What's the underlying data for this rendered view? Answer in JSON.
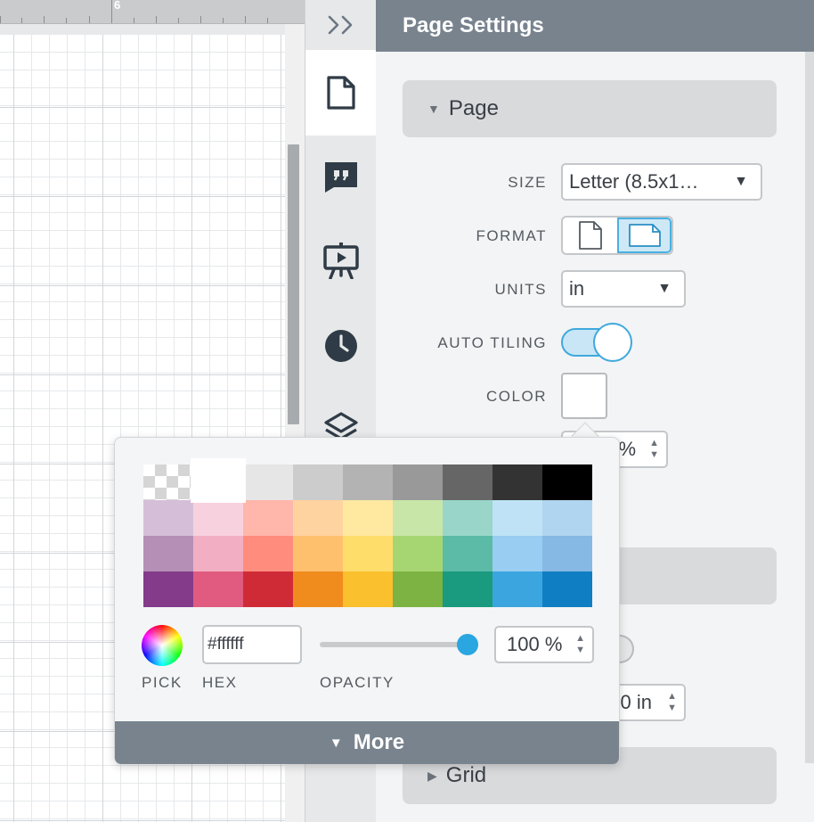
{
  "ruler": {
    "label": "6"
  },
  "rail": {
    "items": [
      {
        "icon": "page-icon",
        "active": true
      },
      {
        "icon": "quote-icon",
        "active": false
      },
      {
        "icon": "presentation-icon",
        "active": false
      },
      {
        "icon": "clock-icon",
        "active": false
      },
      {
        "icon": "layers-icon",
        "active": false
      }
    ]
  },
  "panel": {
    "title": "Page Settings",
    "sections": {
      "page": {
        "label": "Page",
        "expanded": true
      },
      "grid": {
        "label": "Grid",
        "expanded": false
      }
    },
    "fields": {
      "size_label": "SIZE",
      "size_value": "Letter (8.5x1…",
      "format_label": "FORMAT",
      "format_selected": "landscape",
      "units_label": "UNITS",
      "units_value": "in",
      "auto_tiling_label": "AUTO TILING",
      "auto_tiling_on": true,
      "color_label": "COLOR",
      "color_value": "#ffffff",
      "page_opacity_partial": "%",
      "margin_partial": "0 in"
    }
  },
  "color_popover": {
    "palette": [
      [
        "transparent",
        "#ffffff",
        "#e6e6e6",
        "#cccccc",
        "#b3b3b3",
        "#999999",
        "#666666",
        "#333333",
        "#000000"
      ],
      [
        "#d5bfd8",
        "#f8d1de",
        "#ffb6ab",
        "#ffd3a0",
        "#ffe8a0",
        "#c8e6a8",
        "#99d6c9",
        "#bfe2f6",
        "#b0d5f0"
      ],
      [
        "#b58fb5",
        "#f2afc3",
        "#ff8c7c",
        "#ffc06e",
        "#ffdd6b",
        "#a6d672",
        "#5cbba6",
        "#99cdf1",
        "#86b9e4"
      ],
      [
        "#833b8a",
        "#e05b7f",
        "#cf2b37",
        "#f08c1e",
        "#fbc02d",
        "#7cb342",
        "#1a9a7e",
        "#3ba5e0",
        "#107ec2"
      ]
    ],
    "selected": "#ffffff",
    "pick_label": "PICK",
    "hex_label": "HEX",
    "hex_value": "#ffffff",
    "opacity_label": "OPACITY",
    "opacity_value": "100 %",
    "opacity_fraction": 1.0,
    "more_label": "More"
  }
}
